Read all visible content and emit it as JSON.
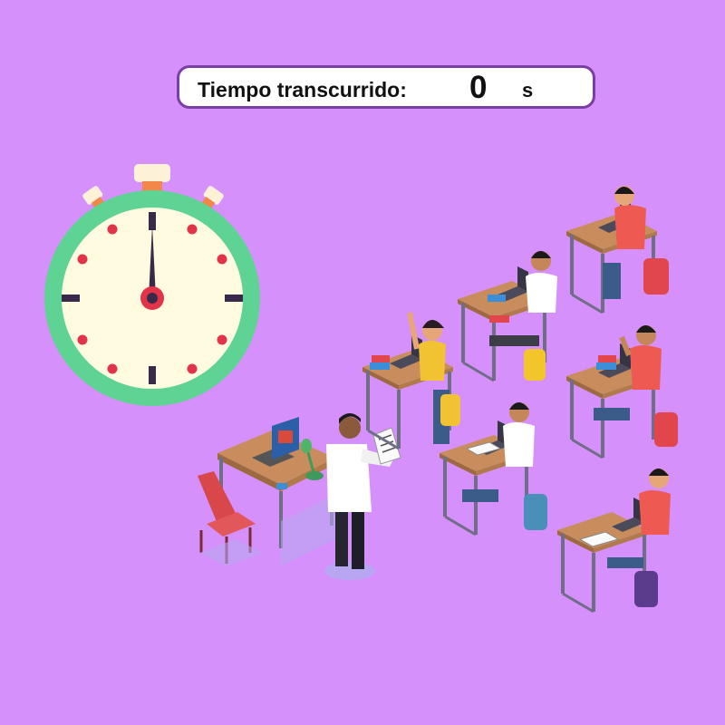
{
  "timer": {
    "label": "Tiempo transcurrido:",
    "value": "0",
    "unit": "s"
  },
  "stopwatch": {
    "hand_fraction": 0,
    "colors": {
      "ring": "#5fd393",
      "face": "#fefbe0",
      "dots": "#e23349",
      "hand": "#3a2a4a"
    }
  },
  "scene": {
    "background": "#d590fb",
    "icons": [
      "stopwatch-icon",
      "teacher-figure",
      "teacher-desk",
      "student-desk"
    ]
  }
}
